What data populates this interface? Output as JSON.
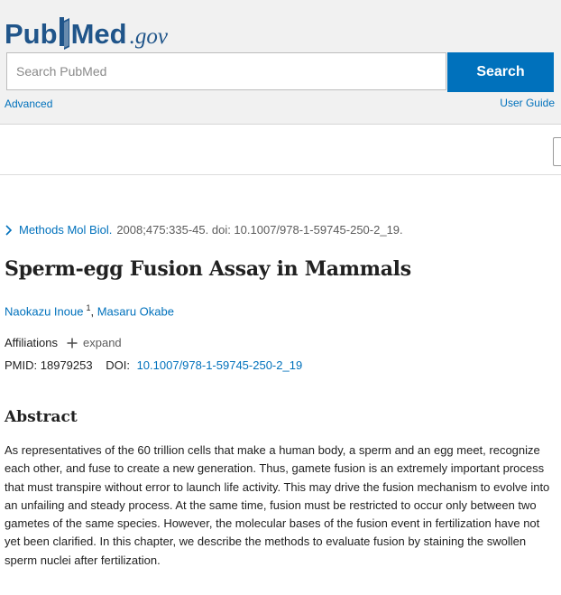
{
  "header": {
    "logo": {
      "pub": "Pub",
      "med": "Med",
      "gov": ".gov"
    },
    "search": {
      "placeholder": "Search PubMed",
      "button_label": "Search"
    },
    "advanced_label": "Advanced",
    "user_guide_label": "User Guide"
  },
  "article": {
    "citation": {
      "journal": "Methods Mol Biol.",
      "details": "2008;475:335-45. doi: 10.1007/978-1-59745-250-2_19."
    },
    "title": "Sperm-egg Fusion Assay in Mammals",
    "authors": [
      {
        "name": "Naokazu Inoue",
        "affiliation_ref": "1"
      },
      {
        "name": "Masaru Okabe"
      }
    ],
    "author_separator": ",",
    "affiliations_label": "Affiliations",
    "expand_label": "expand",
    "pmid_label": "PMID:",
    "pmid": "18979253",
    "doi_label": "DOI:",
    "doi": "10.1007/978-1-59745-250-2_19",
    "abstract_heading": "Abstract",
    "abstract_text": "As representatives of the 60 trillion cells that make a human body, a sperm and an egg meet, recognize each other, and fuse to create a new generation. Thus, gamete fusion is an extremely important process that must transpire without error to launch life activity. This may drive the fusion mechanism to evolve into an unfailing and steady process. At the same time, fusion must be restricted to occur only between two gametes of the same species. However, the molecular bases of the fusion event in fertilization have not yet been clarified. In this chapter, we describe the methods to evaluate fusion by staining the swollen sperm nuclei after fertilization."
  },
  "icons": {
    "chevron": "chevron-right-icon",
    "plus": "plus-icon",
    "logo_book": "book-icon"
  },
  "colors": {
    "brand": "#20558a",
    "link": "#0071bc",
    "header_bg": "#f1f1f1",
    "search_button": "#0071bc"
  }
}
